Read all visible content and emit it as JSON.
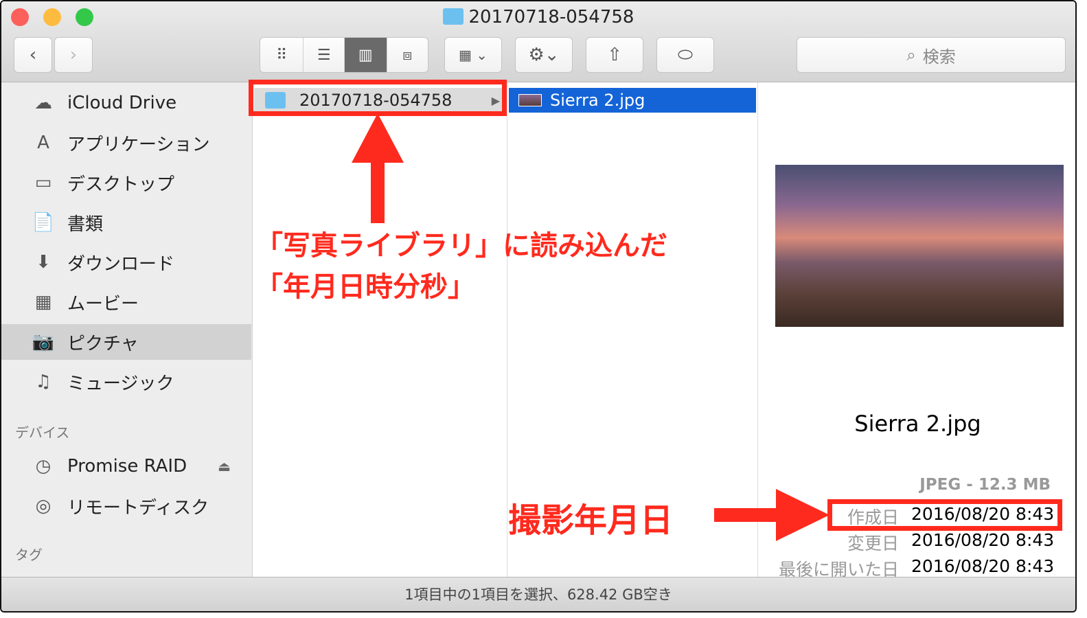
{
  "window": {
    "title": "20170718-054758"
  },
  "toolbar": {
    "back": "‹",
    "forward": "›",
    "search_placeholder": "検索"
  },
  "sidebar": {
    "items": [
      {
        "label": "iCloud Drive",
        "icon": "☁"
      },
      {
        "label": "アプリケーション",
        "icon": "A"
      },
      {
        "label": "デスクトップ",
        "icon": "▭"
      },
      {
        "label": "書類",
        "icon": "📄"
      },
      {
        "label": "ダウンロード",
        "icon": "⬇"
      },
      {
        "label": "ムービー",
        "icon": "▦"
      },
      {
        "label": "ピクチャ",
        "icon": "📷"
      },
      {
        "label": "ミュージック",
        "icon": "♫"
      }
    ],
    "devices_header": "デバイス",
    "devices": [
      {
        "label": "Promise RAID",
        "icon": "◷"
      },
      {
        "label": "リモートディスク",
        "icon": "◎"
      }
    ],
    "tags_header": "タグ"
  },
  "columns": {
    "col1_item": "20170718-054758",
    "col2_item": "Sierra 2.jpg"
  },
  "preview": {
    "filename": "Sierra 2.jpg",
    "kind_size": "JPEG - 12.3 MB",
    "meta": [
      {
        "key": "作成日",
        "value": "2016/08/20 8:43"
      },
      {
        "key": "変更日",
        "value": "2016/08/20 8:43"
      },
      {
        "key": "最後に開いた日",
        "value": "2016/08/20 8:43"
      }
    ]
  },
  "status": "1項目中の1項目を選択、628.42 GB空き",
  "annotations": {
    "line1": "「写真ライブラリ」に読み込んだ",
    "line2": "「年月日時分秒」",
    "date_label": "撮影年月日"
  }
}
